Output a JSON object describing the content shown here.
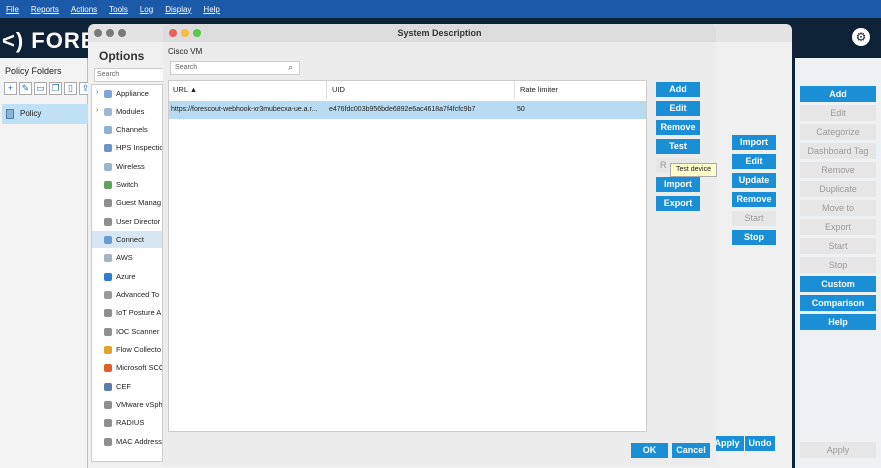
{
  "menubar": [
    "File",
    "Reports",
    "Actions",
    "Tools",
    "Log",
    "Display",
    "Help"
  ],
  "app": {
    "logo": "<) FORES"
  },
  "left_panel": {
    "title": "Policy Folders",
    "items": [
      "Policy"
    ]
  },
  "options": {
    "title": "Options",
    "search_placeholder": "Search",
    "tree": [
      "Appliance",
      "Modules",
      "Channels",
      "HPS Inspectio",
      "Wireless",
      "Switch",
      "Guest Manag",
      "User Director",
      "Connect",
      "AWS",
      "Azure",
      "Advanced To",
      "IoT Posture A",
      "IOC Scanner",
      "Flow Collecto",
      "Microsoft SCC",
      "CEF",
      "VMware vSph",
      "RADIUS",
      "MAC Address"
    ],
    "middle_buttons": [
      "Import",
      "Edit",
      "Update",
      "Remove",
      "Start",
      "Stop"
    ],
    "apply": "Apply",
    "undo": "Undo"
  },
  "right_panel": {
    "buttons": [
      "Add",
      "Edit",
      "Categorize",
      "Dashboard Tag",
      "Remove",
      "Duplicate",
      "Move to",
      "Export",
      "Start",
      "Stop",
      "Custom",
      "Comparison",
      "Help"
    ],
    "apply": "Apply"
  },
  "dialog": {
    "title": "System Description",
    "subtitle": "Cisco VM",
    "search_placeholder": "Search",
    "columns": [
      "URL ▲",
      "UID",
      "Rate limiter"
    ],
    "rows": [
      {
        "url": "https://forescout-webhook-xr3mubecxa-ue.a.r...",
        "uid": "e476fdc003b956bde6892e6ac4618a7f4fcfc9b7",
        "rate": "50"
      }
    ],
    "buttons": [
      "Add",
      "Edit",
      "Remove",
      "Test",
      "R",
      "Import",
      "Export"
    ],
    "tooltip": "Test device",
    "ok": "OK",
    "cancel": "Cancel"
  },
  "colors": {
    "accent": "#1a8fd6",
    "menubar": "#1b5aa8",
    "selection": "#b9dbf2"
  }
}
